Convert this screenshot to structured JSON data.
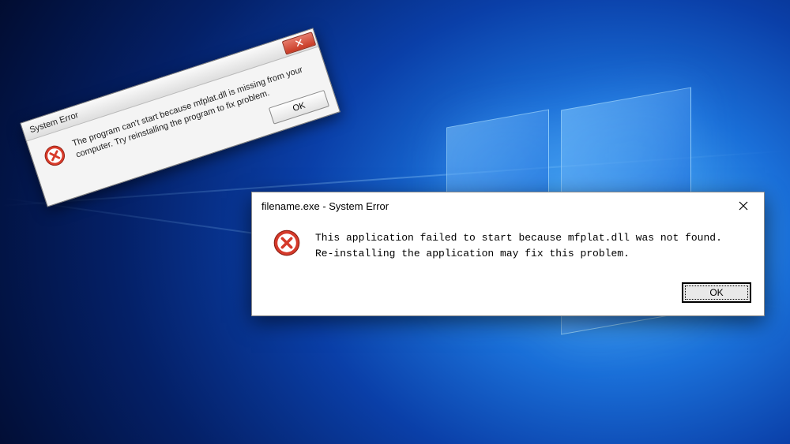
{
  "dialog_front": {
    "title": "filename.exe - System Error",
    "message": "This application failed to start because mfplat.dll was not found. Re-installing the application may fix this problem.",
    "ok_label": "OK"
  },
  "dialog_back": {
    "title": "System Error",
    "message": "The program can't start because mfplat.dll is missing from your computer. Try reinstalling the program to fix problem.",
    "ok_label": "OK"
  }
}
